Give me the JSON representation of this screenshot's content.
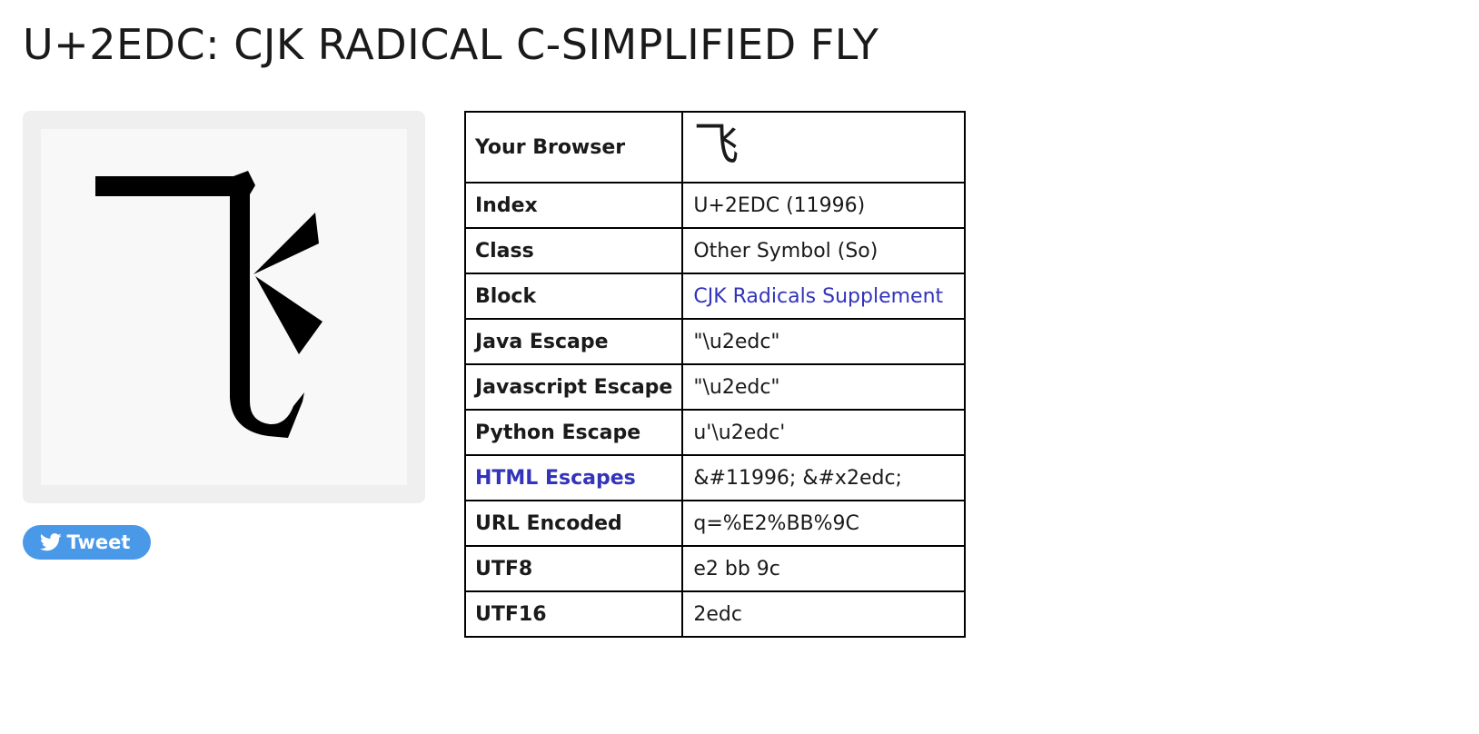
{
  "page": {
    "title": "U+2EDC: CJK RADICAL C-SIMPLIFIED FLY"
  },
  "glyph": {
    "character": "⻜",
    "icon": "cjk-radical-simplified-fly-glyph"
  },
  "tweet": {
    "label": "Tweet",
    "icon": "twitter-bird-icon",
    "color": "#4a99e9"
  },
  "table": {
    "browser": {
      "label": "Your Browser",
      "value": "⻜"
    },
    "index": {
      "label": "Index",
      "value": "U+2EDC (11996)"
    },
    "class": {
      "label": "Class",
      "value": "Other Symbol (So)"
    },
    "block": {
      "label": "Block",
      "value": "CJK Radicals Supplement"
    },
    "java": {
      "label": "Java Escape",
      "value": "\"\\u2edc\""
    },
    "javascript": {
      "label": "Javascript Escape",
      "value": "\"\\u2edc\""
    },
    "python": {
      "label": "Python Escape",
      "value": "u'\\u2edc'"
    },
    "html": {
      "label": "HTML Escapes",
      "value": "&#11996; &#x2edc;"
    },
    "url": {
      "label": "URL Encoded",
      "value": "q=%E2%BB%9C"
    },
    "utf8": {
      "label": "UTF8",
      "value": "e2 bb 9c"
    },
    "utf16": {
      "label": "UTF16",
      "value": "2edc"
    }
  },
  "colors": {
    "link": "#3333bb",
    "card_bg": "#efefef",
    "card_inner_bg": "#f8f8f8"
  }
}
